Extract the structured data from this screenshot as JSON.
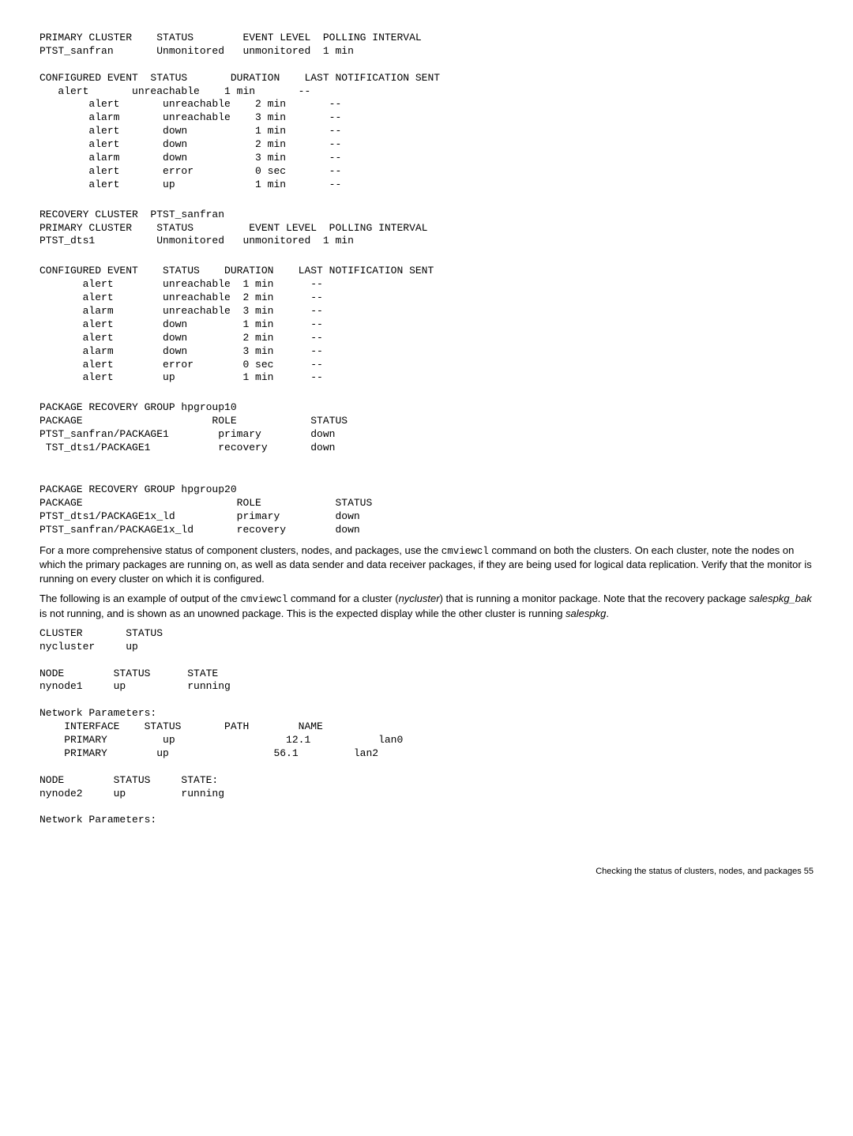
{
  "block1": "PRIMARY CLUSTER    STATUS        EVENT LEVEL  POLLING INTERVAL\nPTST_sanfran       Unmonitored   unmonitored  1 min\n\nCONFIGURED EVENT  STATUS       DURATION    LAST NOTIFICATION SENT\n   alert       unreachable    1 min       --\n        alert       unreachable    2 min       --\n        alarm       unreachable    3 min       --\n        alert       down           1 min       --\n        alert       down           2 min       --\n        alarm       down           3 min       --\n        alert       error          0 sec       --\n        alert       up             1 min       --",
  "block2": "RECOVERY CLUSTER  PTST_sanfran\nPRIMARY CLUSTER    STATUS         EVENT LEVEL  POLLING INTERVAL\nPTST_dts1          Unmonitored   unmonitored  1 min",
  "block3": "CONFIGURED EVENT    STATUS    DURATION    LAST NOTIFICATION SENT\n       alert        unreachable  1 min      --\n       alert        unreachable  2 min      --\n       alarm        unreachable  3 min      --\n       alert        down         1 min      --\n       alert        down         2 min      --\n       alarm        down         3 min      --\n       alert        error        0 sec      --\n       alert        up           1 min      --",
  "block4": "PACKAGE RECOVERY GROUP hpgroup10\nPACKAGE                     ROLE            STATUS\nPTST_sanfran/PACKAGE1        primary        down\n TST_dts1/PACKAGE1           recovery       down",
  "block5": "PACKAGE RECOVERY GROUP hpgroup20\nPACKAGE                         ROLE            STATUS\nPTST_dts1/PACKAGE1x_ld          primary         down\nPTST_sanfran/PACKAGE1x_ld       recovery        down",
  "prose1_a": "For a more comprehensive status of component clusters, nodes, and packages, use the ",
  "prose1_code": "cmviewcl",
  "prose1_b": " command on both the clusters. On each cluster, note the nodes on which the primary packages are running on, as well as data sender and data receiver packages, if they are being used for logical data replication. Verify that the monitor is running on every cluster on which it is configured.",
  "prose2_a": "The following is an example of output of the ",
  "prose2_code": "cmviewcl",
  "prose2_b": " command for a cluster (",
  "prose2_em1": "nycluster",
  "prose2_c": ") that is running a monitor package. Note that the recovery package ",
  "prose2_em2": "salespkg_bak",
  "prose2_d": " is not running, and is shown as an unowned package. This is the expected display while the other cluster is running ",
  "prose2_em3": "salespkg",
  "prose2_e": ".",
  "block6": "CLUSTER       STATUS\nnycluster     up\n\nNODE        STATUS      STATE\nnynode1     up          running\n\nNetwork Parameters:\n    INTERFACE    STATUS       PATH        NAME\n    PRIMARY         up                  12.1           lan0\n    PRIMARY        up                 56.1         lan2\n\nNODE        STATUS     STATE:\nnynode2     up         running\n\nNetwork Parameters:",
  "footer": "Checking the status of clusters, nodes, and packages    55"
}
